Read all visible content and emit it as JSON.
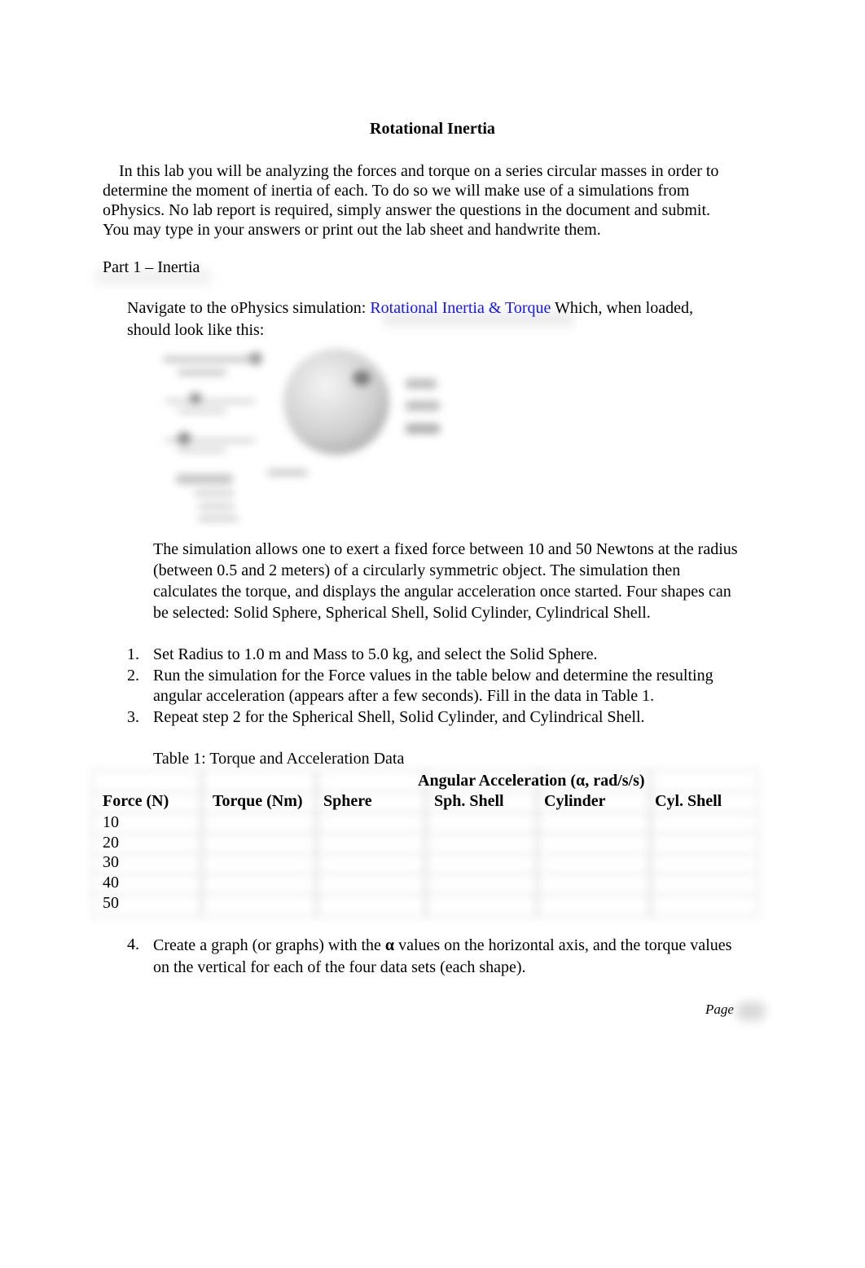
{
  "document": {
    "title": "Rotational Inertia",
    "intro_lines": [
      "In this lab you will be analyzing the forces and torque on a series circular masses in order to",
      "determine the moment of inertia of each. To do so we will make use of a simulations from",
      "oPhysics. No lab report is required, simply answer the questions in the document and submit.",
      "You may type in your answers or print out the lab sheet and handwrite them."
    ],
    "part_heading": "Part 1 – Inertia",
    "navigate": {
      "prefix": "Navigate to the oPhysics simulation: ",
      "link_text": "Rotational Inertia & Torque",
      "suffix": " Which, when loaded,",
      "line2": "should look like this:",
      "link_color": "#1414ff"
    },
    "image": {
      "description": "blurred screenshot of oPhysics rotational inertia simulation (sphere with control sliders)"
    },
    "description_lines": [
      "The simulation allows one to exert a fixed force between 10 and 50 Newtons at the radius",
      "(between 0.5 and 2 meters) of a circularly symmetric object. The simulation then",
      "calculates the torque, and displays the angular acceleration once started. Four shapes can",
      "be selected: Solid Sphere, Spherical Shell, Solid Cylinder, Cylindrical Shell."
    ],
    "steps": [
      {
        "num": "1.",
        "lines": [
          "Set Radius to 1.0 m and Mass to 5.0 kg, and select the Solid Sphere."
        ]
      },
      {
        "num": "2.",
        "lines": [
          "Run the simulation for the Force values in the table below and determine the resulting",
          "angular acceleration (appears after a few seconds). Fill in the data in Table 1."
        ]
      },
      {
        "num": "3.",
        "lines": [
          "Repeat step 2 for the Spherical Shell, Solid Cylinder, and Cylindrical Shell."
        ]
      }
    ],
    "table": {
      "caption": "Table 1: Torque and Acceleration Data",
      "group_header": "Angular Acceleration (α, rad/s/s)",
      "columns": [
        "Force (N)",
        "Torque (Nm)",
        "Sphere",
        "Sph. Shell",
        "Cylinder",
        "Cyl. Shell"
      ],
      "rows": [
        [
          "10",
          "",
          "",
          "",
          "",
          ""
        ],
        [
          "20",
          "",
          "",
          "",
          "",
          ""
        ],
        [
          "30",
          "",
          "",
          "",
          "",
          ""
        ],
        [
          "40",
          "",
          "",
          "",
          "",
          ""
        ],
        [
          "50",
          "",
          "",
          "",
          "",
          ""
        ]
      ]
    },
    "step4": {
      "num": "4.",
      "line1_prefix": "Create a graph (or graphs) with the ",
      "line1_bold": "α",
      "line1_suffix": " values on the horizontal axis, and the torque values",
      "line2": "on the vertical for each of the four data sets (each shape)."
    },
    "footer": {
      "page_label": "Page"
    }
  }
}
